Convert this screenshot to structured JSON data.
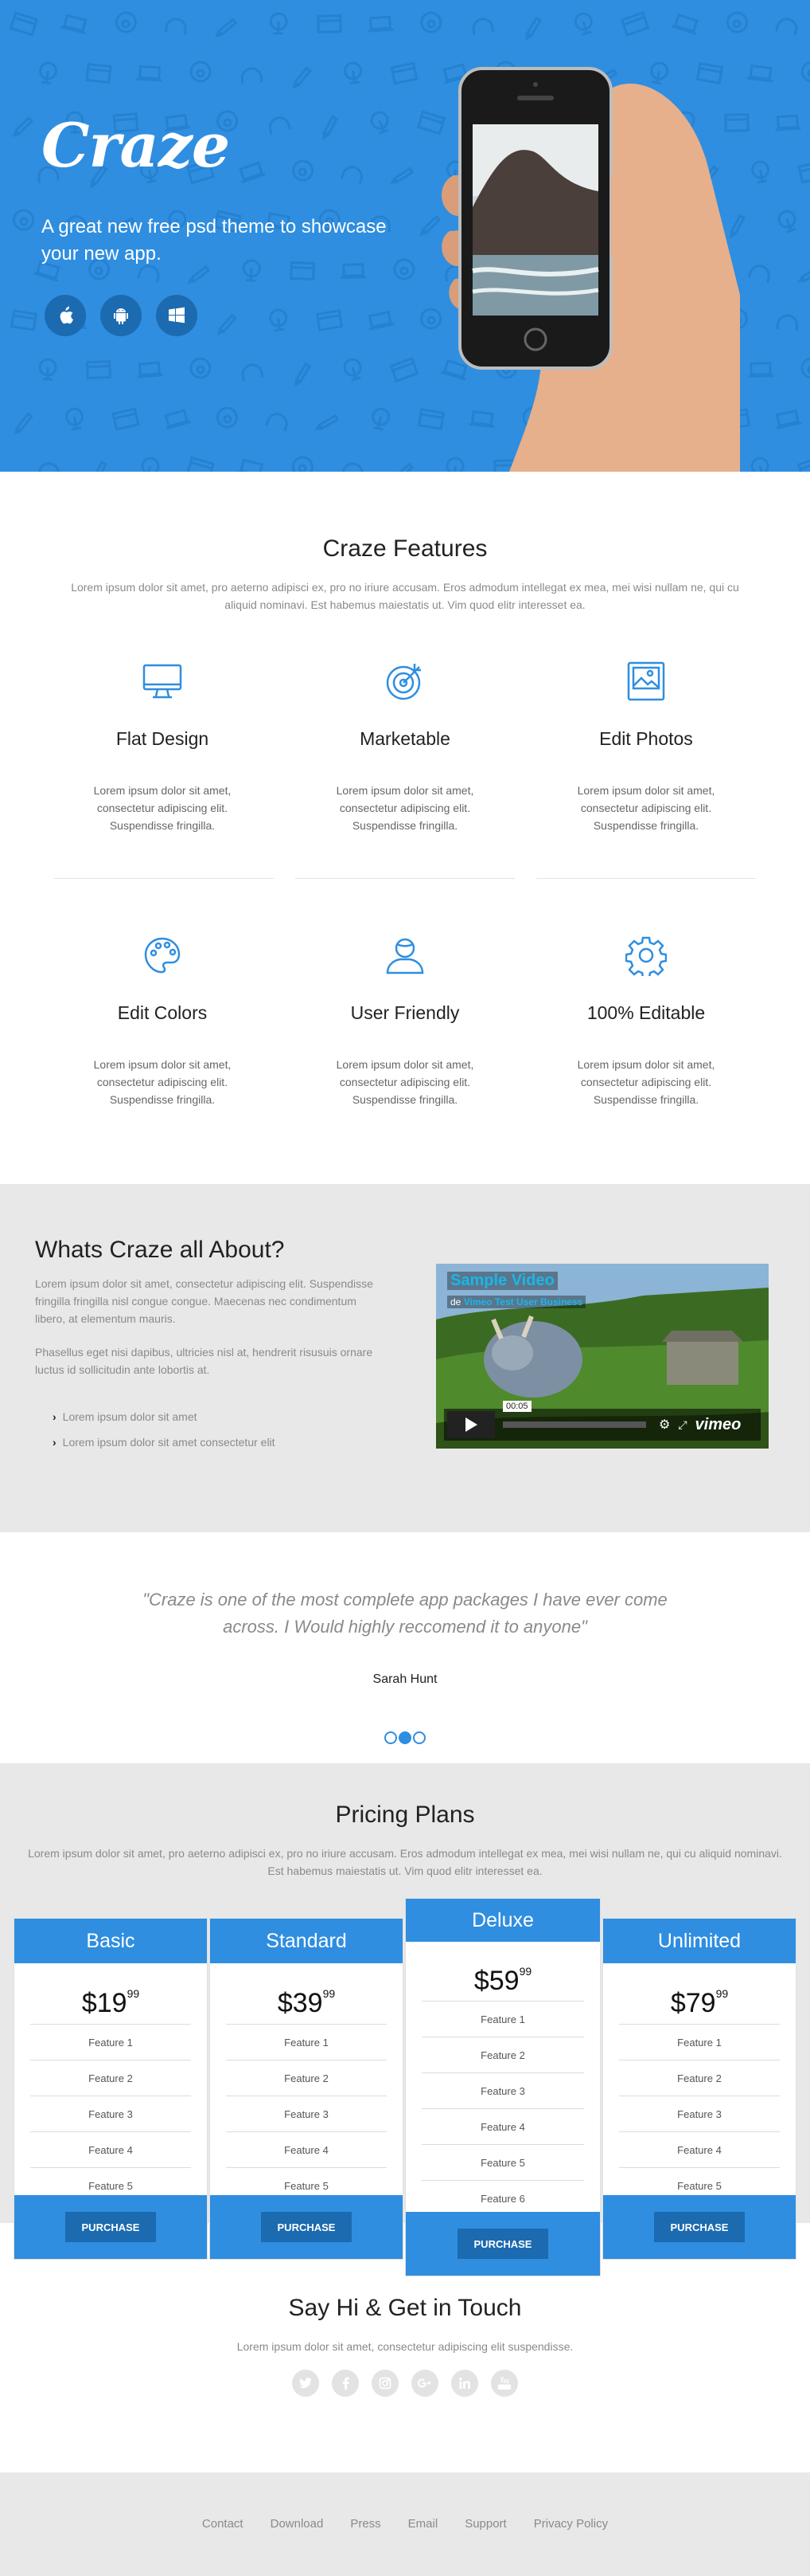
{
  "hero": {
    "logo": "Craze",
    "tagline": "A great new free psd theme to showcase your new app.",
    "store_icons": [
      "apple-icon",
      "android-icon",
      "windows-icon"
    ]
  },
  "features": {
    "title": "Craze Features",
    "lead": "Lorem ipsum dolor sit amet, pro aeterno adipisci ex, pro no iriure accusam. Eros admodum intellegat ex mea, mei wisi nullam ne, qui cu aliquid nominavi. Est habemus maiestatis ut. Vim quod elitr interesset ea.",
    "items": [
      {
        "icon": "monitor-icon",
        "title": "Flat Design",
        "text": "Lorem ipsum dolor sit amet, consectetur adipiscing elit. Suspendisse fringilla."
      },
      {
        "icon": "target-icon",
        "title": "Marketable",
        "text": "Lorem ipsum dolor sit amet, consectetur adipiscing elit. Suspendisse fringilla."
      },
      {
        "icon": "picture-icon",
        "title": "Edit Photos",
        "text": "Lorem ipsum dolor sit amet, consectetur adipiscing elit. Suspendisse fringilla."
      },
      {
        "icon": "palette-icon",
        "title": "Edit Colors",
        "text": "Lorem ipsum dolor sit amet, consectetur adipiscing elit. Suspendisse fringilla."
      },
      {
        "icon": "user-icon",
        "title": "User Friendly",
        "text": "Lorem ipsum dolor sit amet, consectetur adipiscing elit. Suspendisse fringilla."
      },
      {
        "icon": "gear-icon",
        "title": "100% Editable",
        "text": "Lorem ipsum dolor sit amet, consectetur adipiscing elit. Suspendisse fringilla."
      }
    ]
  },
  "about": {
    "title": "Whats Craze all About?",
    "p1": "Lorem ipsum dolor sit amet, consectetur adipiscing elit. Suspendisse fringilla fringilla nisl congue congue. Maecenas nec condimentum libero, at elementum mauris.",
    "p2": "Phasellus eget nisi dapibus, ultricies nisl at, hendrerit risusuis ornare luctus id sollicitudin ante lobortis at.",
    "bullets": [
      "Lorem ipsum dolor sit amet",
      "Lorem ipsum dolor sit amet consectetur elit"
    ],
    "video": {
      "title": "Sample Video",
      "byline_prefix": "de",
      "byline": "Vimeo Test User Business",
      "time": "00:05",
      "brand": "vimeo"
    }
  },
  "testimonial": {
    "quote": "\"Craze is one of the most complete app packages I have ever come across. I Would highly reccomend it to anyone\"",
    "author": "Sarah Hunt",
    "active_dot": 1
  },
  "pricing": {
    "title": "Pricing Plans",
    "lead": "Lorem ipsum dolor sit amet, pro aeterno adipisci ex, pro no iriure accusam. Eros admodum intellegat ex mea, mei wisi nullam ne, qui cu aliquid nominavi. Est habemus maiestatis ut. Vim quod elitr interesset ea.",
    "plans": [
      {
        "name": "Basic",
        "dollars": "$19",
        "cents": "99",
        "features": [
          "Feature 1",
          "Feature 2",
          "Feature 3",
          "Feature 4",
          "Feature 5"
        ],
        "button": "PURCHASE"
      },
      {
        "name": "Standard",
        "dollars": "$39",
        "cents": "99",
        "features": [
          "Feature 1",
          "Feature 2",
          "Feature 3",
          "Feature 4",
          "Feature 5"
        ],
        "button": "PURCHASE"
      },
      {
        "name": "Deluxe",
        "dollars": "$59",
        "cents": "99",
        "features": [
          "Feature 1",
          "Feature 2",
          "Feature 3",
          "Feature 4",
          "Feature 5",
          "Feature 6"
        ],
        "button": "PURCHASE",
        "featured": true
      },
      {
        "name": "Unlimited",
        "dollars": "$79",
        "cents": "99",
        "features": [
          "Feature 1",
          "Feature 2",
          "Feature 3",
          "Feature 4",
          "Feature 5"
        ],
        "button": "PURCHASE"
      }
    ]
  },
  "contact": {
    "title": "Say Hi & Get in Touch",
    "lead": "Lorem ipsum dolor sit amet, consectetur adipiscing elit suspendisse.",
    "socials": [
      "twitter-icon",
      "facebook-icon",
      "instagram-icon",
      "google-plus-icon",
      "linkedin-icon",
      "youtube-icon"
    ]
  },
  "footer": {
    "links": [
      "Contact",
      "Download",
      "Press",
      "Email",
      "Support",
      "Privacy Policy"
    ]
  },
  "colors": {
    "accent": "#2f8ee0",
    "accent_dark": "#1c6ab0",
    "gray_bg": "#e8e8e8",
    "muted_text": "#8a8a8a"
  }
}
